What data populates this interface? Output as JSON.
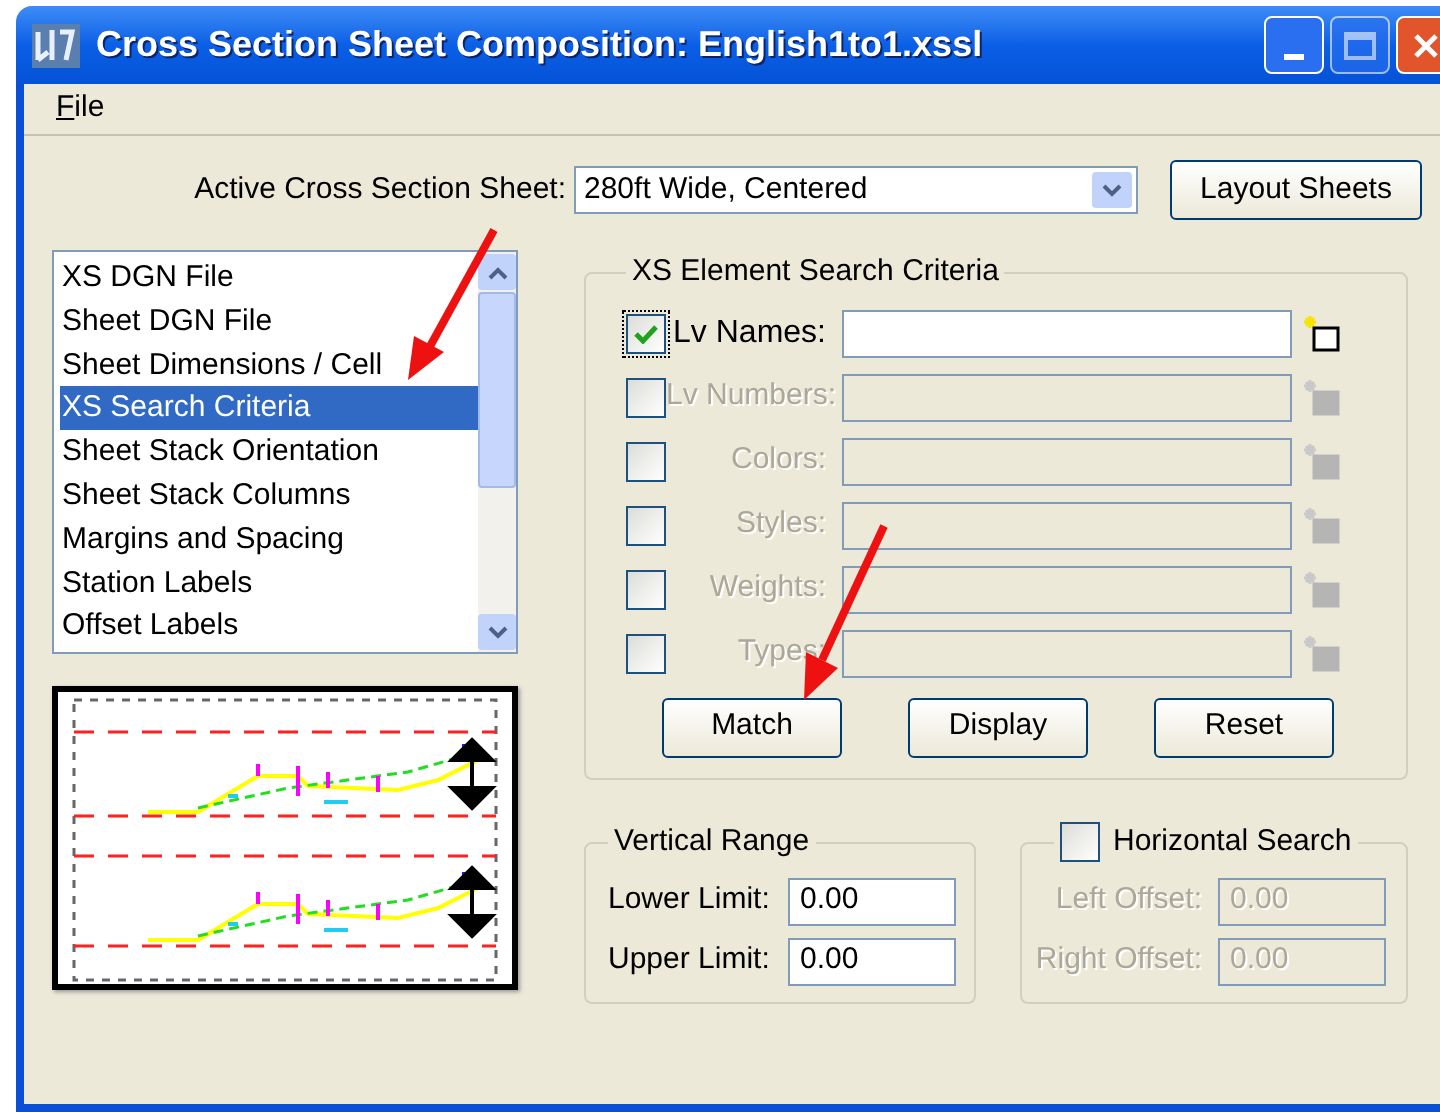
{
  "window": {
    "title": "Cross Section Sheet Composition: English1to1.xssl"
  },
  "menu": [
    {
      "label": "File",
      "underline_first": true
    }
  ],
  "active_sheet": {
    "label": "Active Cross Section Sheet:",
    "value": "280ft Wide, Centered"
  },
  "layout_button": "Layout Sheets",
  "sections": [
    {
      "label": "XS DGN File",
      "selected": false
    },
    {
      "label": "Sheet DGN File",
      "selected": false
    },
    {
      "label": "Sheet Dimensions / Cell",
      "selected": false
    },
    {
      "label": "XS Search Criteria",
      "selected": true
    },
    {
      "label": "Sheet Stack Orientation",
      "selected": false
    },
    {
      "label": "Sheet Stack Columns",
      "selected": false
    },
    {
      "label": "Margins and Spacing",
      "selected": false
    },
    {
      "label": "Station Labels",
      "selected": false
    },
    {
      "label": "Offset Labels",
      "selected": false
    }
  ],
  "search_criteria": {
    "title": "XS Element Search Criteria",
    "rows": [
      {
        "label": "Lv Names:",
        "checked": true,
        "disabled": false
      },
      {
        "label": "Lv Numbers:",
        "checked": false,
        "disabled": true
      },
      {
        "label": "Colors:",
        "checked": false,
        "disabled": true
      },
      {
        "label": "Styles:",
        "checked": false,
        "disabled": true
      },
      {
        "label": "Weights:",
        "checked": false,
        "disabled": true
      },
      {
        "label": "Types:",
        "checked": false,
        "disabled": true
      }
    ],
    "buttons": [
      "Match",
      "Display",
      "Reset"
    ]
  },
  "vertical_range": {
    "title": "Vertical Range",
    "fields": [
      {
        "label": "Lower Limit:",
        "value": "0.00",
        "disabled": false
      },
      {
        "label": "Upper Limit:",
        "value": "0.00",
        "disabled": false
      }
    ]
  },
  "horizontal_search": {
    "title": "Horizontal Search",
    "checked": false,
    "fields": [
      {
        "label": "Left Offset:",
        "value": "0.00",
        "disabled": true
      },
      {
        "label": "Right Offset:",
        "value": "0.00",
        "disabled": true
      }
    ]
  }
}
